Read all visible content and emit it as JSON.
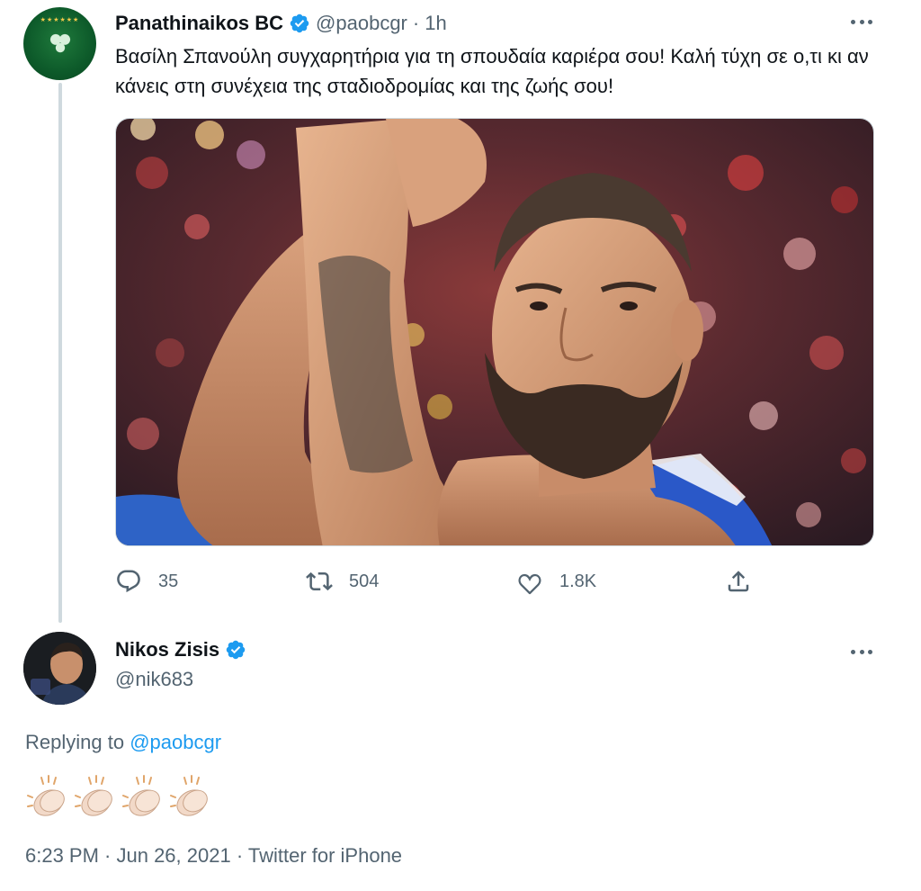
{
  "tweet1": {
    "author_name": "Panathinaikos BC",
    "handle": "@paobcgr",
    "separator": "·",
    "time": "1h",
    "text": "Βασίλη Σπανούλη συγχαρητήρια για τη σπουδαία καριέρα σου! Καλή τύχη σε ο,τι κι αν κάνεις στη συνέχεια της σταδιοδρομίας και της ζωής σου!",
    "avatar_icon": "clover-logo-icon",
    "media_icon": "basketball-player-photo",
    "replies": "35",
    "retweets": "504",
    "likes": "1.8K"
  },
  "tweet2": {
    "author_name": "Nikos Zisis",
    "handle": "@nik683",
    "replying_prefix": "Replying to",
    "replying_to": "@paobcgr",
    "body_emoji": [
      "clapping-hands-icon",
      "clapping-hands-icon",
      "clapping-hands-icon",
      "clapping-hands-icon"
    ],
    "timestamp": "6:23 PM · Jun 26, 2021 · Twitter for iPhone"
  },
  "colors": {
    "text": "#0f1419",
    "secondary": "#536471",
    "accent": "#1d9bf0",
    "border": "#cfd9de"
  }
}
